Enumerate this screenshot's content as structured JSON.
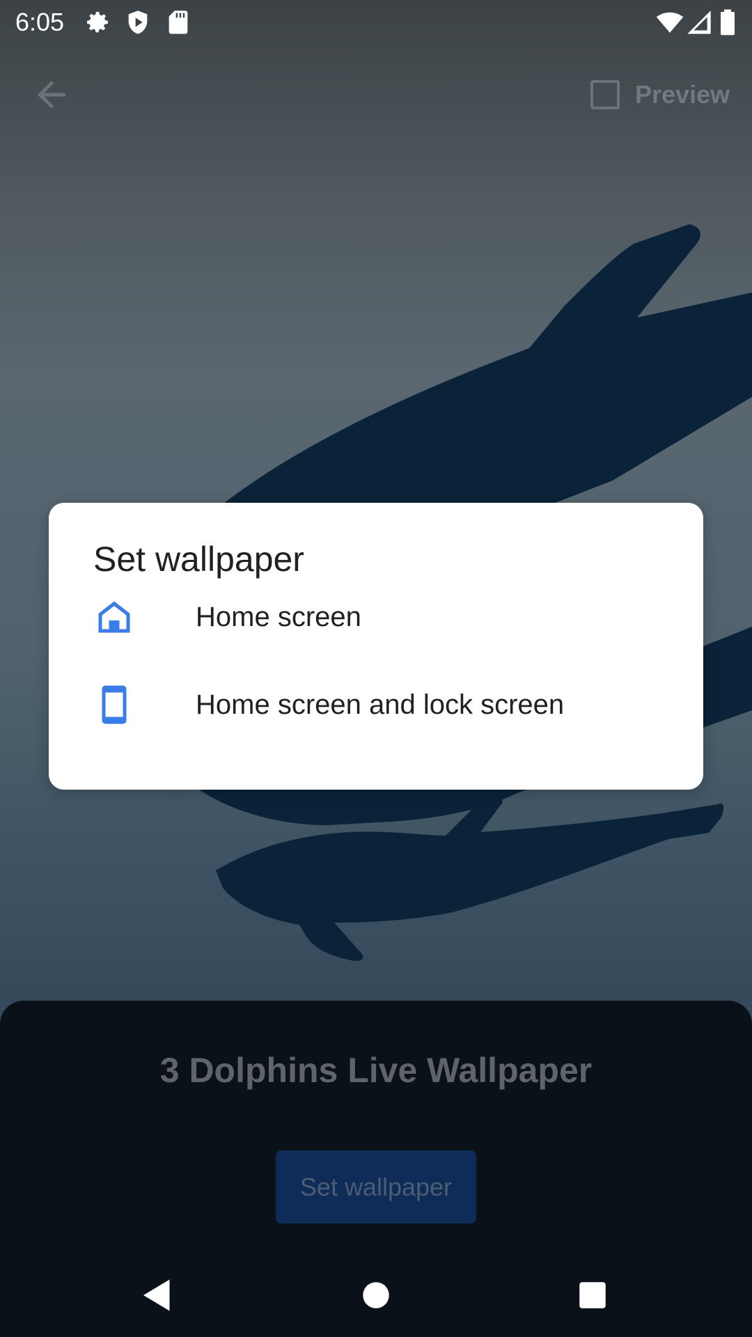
{
  "status_bar": {
    "time": "6:05",
    "icons": [
      "gear-icon",
      "shield-icon",
      "sd-card-icon",
      "wifi-icon",
      "signal-icon",
      "battery-icon"
    ]
  },
  "app_bar": {
    "back_icon": "arrow-back-icon",
    "preview_label": "Preview"
  },
  "wallpaper": {
    "name": "3 Dolphins Live Wallpaper",
    "set_button_label": "Set wallpaper"
  },
  "dialog": {
    "title": "Set wallpaper",
    "options": [
      {
        "icon": "home-icon",
        "label": "Home screen"
      },
      {
        "icon": "phone-icon",
        "label": "Home screen and lock screen"
      }
    ]
  },
  "nav_bar": {
    "icons": [
      "back-triangle-icon",
      "home-circle-icon",
      "recents-square-icon"
    ]
  },
  "colors": {
    "accent": "#3a7de8",
    "dolphin": "#0a2338",
    "button_bg": "#0e2c57",
    "panel_bg": "#0a1118"
  }
}
